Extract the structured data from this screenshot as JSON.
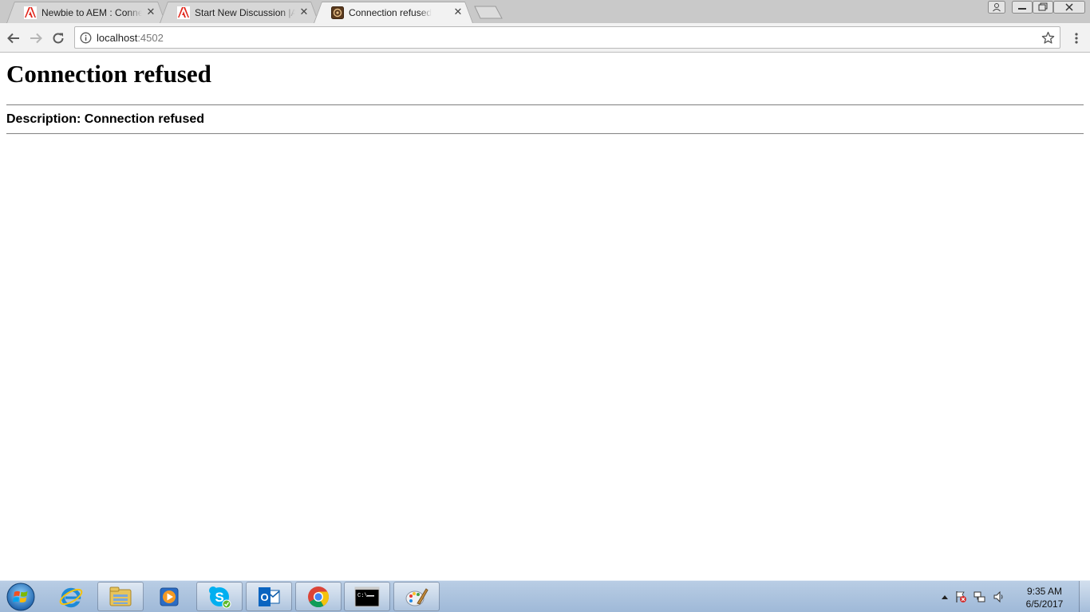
{
  "browser": {
    "tabs": [
      {
        "title": "Newbie to AEM : Connec",
        "favicon": "adobe-icon",
        "active": false
      },
      {
        "title": "Start New Discussion |Ad",
        "favicon": "adobe-icon",
        "active": false
      },
      {
        "title": "Connection refused",
        "favicon": "error-page-icon",
        "active": true
      }
    ],
    "address_bar": {
      "host": "localhost",
      "port": ":4502"
    }
  },
  "page": {
    "heading": "Connection refused",
    "description": "Description: Connection refused"
  },
  "taskbar": {
    "pinned": [
      {
        "name": "internet-explorer-icon",
        "running": false
      },
      {
        "name": "file-explorer-icon",
        "running": true
      },
      {
        "name": "media-player-icon",
        "running": false
      },
      {
        "name": "skype-icon",
        "running": true
      },
      {
        "name": "outlook-icon",
        "running": true
      },
      {
        "name": "chrome-icon",
        "running": true
      },
      {
        "name": "command-prompt-icon",
        "running": true
      },
      {
        "name": "paint-icon",
        "running": true
      }
    ],
    "clock": {
      "time": "9:35 AM",
      "date": "6/5/2017"
    }
  },
  "colors": {
    "tabstrip": "#c9c9c9",
    "toolbar": "#f2f2f2",
    "taskbar": "#b9cde4",
    "adobe_red": "#e1251b"
  }
}
